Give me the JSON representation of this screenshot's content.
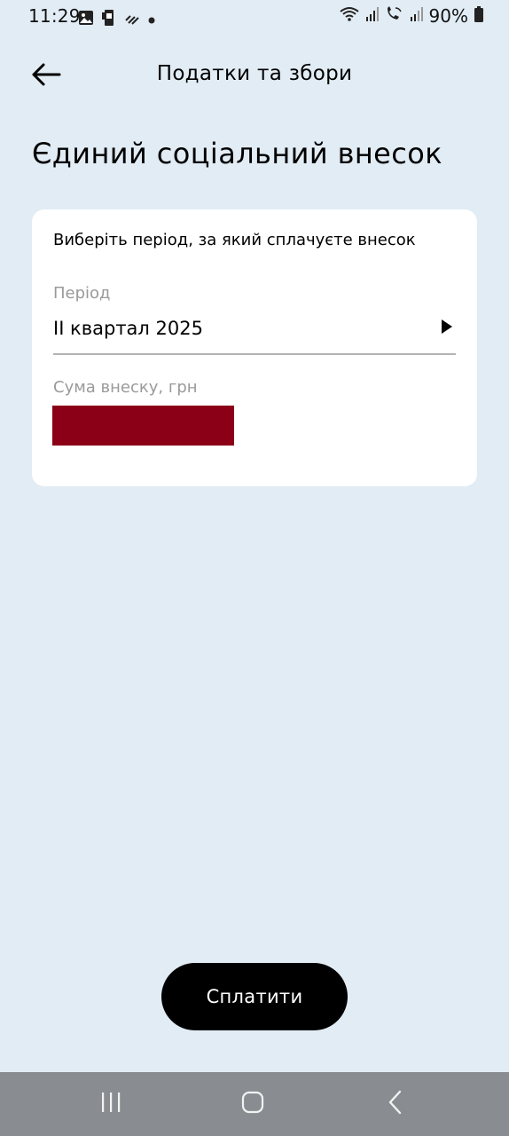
{
  "status_bar": {
    "time": "11:29",
    "battery": "90%",
    "left_icons": [
      "image-icon",
      "vpn-icon",
      "data-saver-icon",
      "dot-icon"
    ],
    "right_icons": [
      "wifi-icon",
      "signal-icon",
      "wifi-call-icon",
      "signal-icon-2",
      "battery-icon"
    ]
  },
  "header": {
    "title": "Податки та збори",
    "back_icon": "arrow-left-icon"
  },
  "page": {
    "title": "Єдиний соціальний внесок"
  },
  "form": {
    "instruction": "Виберіть період, за який сплачуєте внесок",
    "period_label": "Період",
    "period_value": "II квартал 2025",
    "period_icon": "triangle-right-icon",
    "amount_label": "Сума внеску, грн",
    "amount_redaction_color": "#8b0016"
  },
  "actions": {
    "pay_label": "Сплатити"
  },
  "nav_bar": {
    "icons": [
      "recent-apps-icon",
      "home-icon",
      "back-nav-icon"
    ]
  },
  "colors": {
    "background": "#e2ecf4",
    "card": "#ffffff",
    "primary_button": "#000000",
    "nav_bar": "#898d91"
  }
}
